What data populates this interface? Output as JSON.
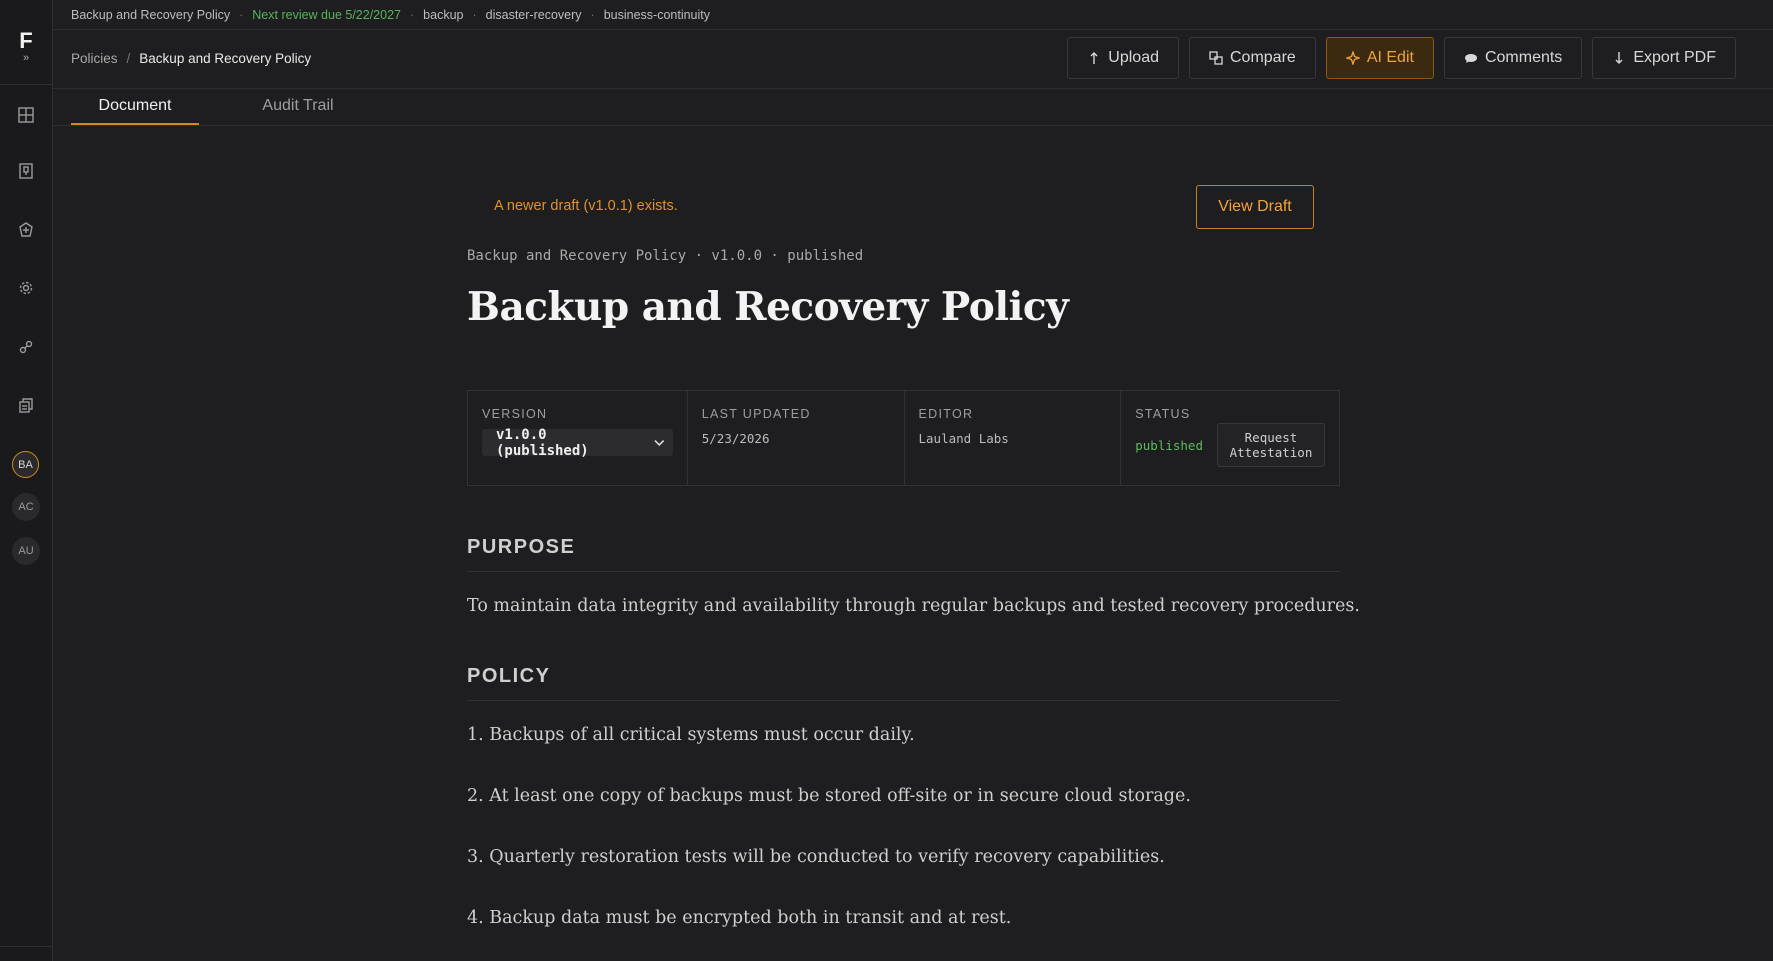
{
  "app": {
    "logo": "F",
    "logo_sub": "»"
  },
  "sidebar": {
    "icons": [
      "grid-icon",
      "book-icon",
      "shield-icon",
      "gear-icon",
      "link-icon",
      "copy-icon"
    ],
    "avatars": [
      {
        "initials": "BA",
        "active": true
      },
      {
        "initials": "AC",
        "active": false
      },
      {
        "initials": "AU",
        "active": false
      }
    ]
  },
  "topbar": {
    "doc_name": "Backup and Recovery Policy",
    "review": "Next review due 5/22/2027",
    "tags": [
      "backup",
      "disaster-recovery",
      "business-continuity"
    ]
  },
  "breadcrumb": {
    "parent": "Policies",
    "current": "Backup and Recovery Policy"
  },
  "toolbar": {
    "upload": "Upload",
    "compare": "Compare",
    "ai_edit": "AI Edit",
    "comments": "Comments",
    "export_pdf": "Export PDF"
  },
  "tabs": {
    "document": "Document",
    "audit_trail": "Audit Trail"
  },
  "notice": {
    "text": "A newer draft (v1.0.1) exists.",
    "button": "View Draft"
  },
  "document": {
    "meta_line": "Backup and Recovery Policy · v1.0.0 · published",
    "title": "Backup and Recovery Policy",
    "meta": {
      "version_label": "VERSION",
      "version_value": "v1.0.0 (published)",
      "updated_label": "LAST UPDATED",
      "updated_value": "5/23/2026",
      "editor_label": "EDITOR",
      "editor_value": "Lauland Labs",
      "status_label": "STATUS",
      "status_value": "published",
      "attest_line1": "Request",
      "attest_line2": "Attestation"
    },
    "purpose_heading": "PURPOSE",
    "purpose_text": "To maintain data integrity and availability through regular backups and tested recovery procedures.",
    "policy_heading": "POLICY",
    "policy_items": [
      "1. Backups of all critical systems must occur daily.",
      "2. At least one copy of backups must be stored off-site or in secure cloud storage.",
      "3. Quarterly restoration tests will be conducted to verify recovery capabilities.",
      "4. Backup data must be encrypted both in transit and at rest."
    ]
  }
}
